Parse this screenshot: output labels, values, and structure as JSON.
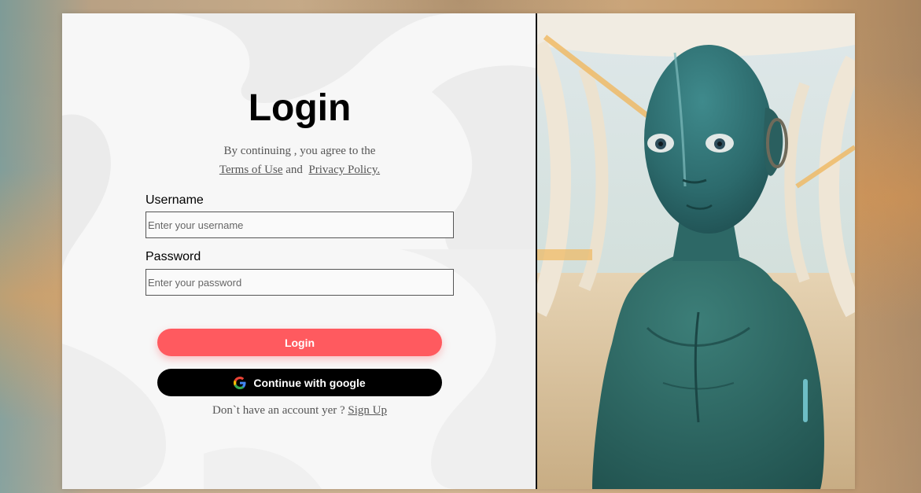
{
  "login": {
    "title": "Login",
    "agree_text": "By continuing , you agree to the",
    "terms_link": "Terms of Use",
    "and_text": "and",
    "privacy_link": "Privacy Policy.",
    "username": {
      "label": "Username",
      "placeholder": "Enter your username",
      "value": ""
    },
    "password": {
      "label": "Password",
      "placeholder": "Enter your password",
      "value": ""
    },
    "login_button": "Login",
    "google_button": "Continue with google",
    "google_icon": "google-g-icon",
    "signup_prompt": "Don`t have an account yer ?",
    "signup_link": "Sign Up"
  },
  "colors": {
    "login_button": "#ff5a5f",
    "google_button": "#000000",
    "panel_bg": "#f7f7f7"
  },
  "hero_image": {
    "subject": "alien-illustration"
  }
}
